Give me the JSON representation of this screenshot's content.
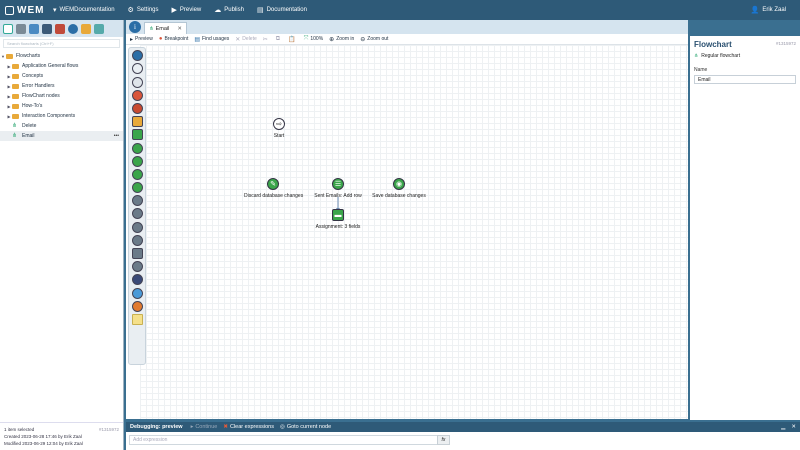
{
  "topbar": {
    "brand": "WEM",
    "items": [
      {
        "icon": "chevron-down-icon",
        "label": "WEMDocumentation"
      },
      {
        "icon": "gear-icon",
        "label": "Settings"
      },
      {
        "icon": "play-icon",
        "label": "Preview"
      },
      {
        "icon": "cloud-icon",
        "label": "Publish"
      },
      {
        "icon": "book-icon",
        "label": "Documentation"
      }
    ],
    "user": "Erik Zaal"
  },
  "left": {
    "search_placeholder": "Search flowcharts (Ctrl+F)",
    "tree": [
      {
        "label": "Flowcharts",
        "type": "folder",
        "level": 0,
        "expanded": true
      },
      {
        "label": "Application General flows",
        "type": "folder",
        "level": 1
      },
      {
        "label": "Concepts",
        "type": "folder",
        "level": 1
      },
      {
        "label": "Error Handlers",
        "type": "folder",
        "level": 1
      },
      {
        "label": "FlowChart nodes",
        "type": "folder",
        "level": 1
      },
      {
        "label": "How-To's",
        "type": "folder",
        "level": 1
      },
      {
        "label": "Interaction Components",
        "type": "folder",
        "level": 1
      },
      {
        "label": "Delete",
        "type": "flowchart",
        "level": 1
      },
      {
        "label": "Email",
        "type": "flowchart",
        "level": 1,
        "selected": true
      }
    ],
    "status": {
      "selected": "1 item selected",
      "id": "#1315972",
      "created": "Created 2023-06-28 17:46 by Erik Zaal",
      "modified": "Modified 2023-06-29 12:04 by Erik Zaal"
    }
  },
  "editor": {
    "tab": "Email",
    "toolbar": [
      {
        "label": "Preview",
        "enabled": true
      },
      {
        "label": "Breakpoint",
        "enabled": true
      },
      {
        "label": "Find usages",
        "enabled": true
      },
      {
        "label": "Delete",
        "enabled": false
      },
      {
        "label": "100%",
        "enabled": true
      },
      {
        "label": "Zoom in",
        "enabled": true
      },
      {
        "label": "Zoom out",
        "enabled": true
      }
    ],
    "nodes": {
      "start": "Start",
      "discard": "Discard database changes",
      "sent": "Sent Emails: Add row",
      "save": "Save database changes",
      "assignment": "Assignment: 3 fields"
    }
  },
  "right": {
    "title": "Flowchart",
    "id": "#1315972",
    "type": "Regular flowchart",
    "name_label": "Name",
    "name_value": "Email"
  },
  "debug": {
    "title": "Debugging: preview",
    "continue": "Continue",
    "clear": "Clear expressions",
    "goto": "Goto current node",
    "expr_placeholder": "Add expression",
    "fx": "fx"
  },
  "colors": {
    "topbar": "#2e5a78",
    "accent": "#3a6f90",
    "node_green": "#3aa54a",
    "folder": "#e8a93a"
  }
}
